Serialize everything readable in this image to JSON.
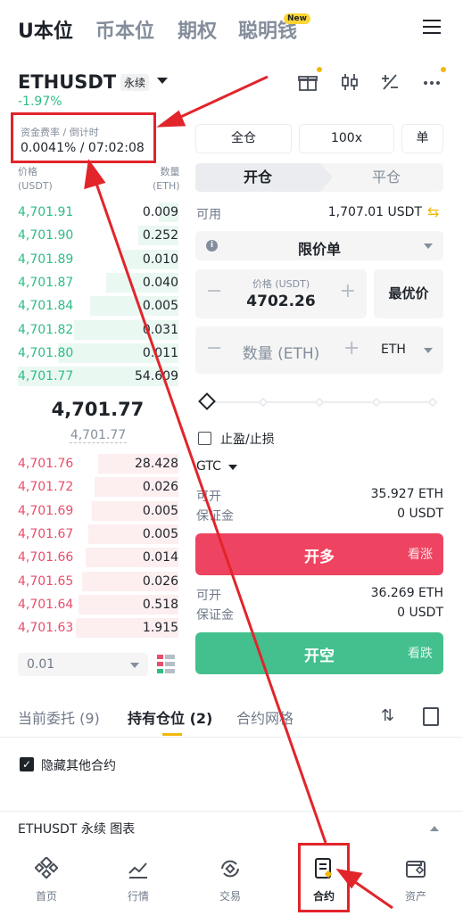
{
  "top_tabs": [
    "U本位",
    "币本位",
    "期权",
    "聪明钱"
  ],
  "new_badge": "New",
  "pair": {
    "name": "ETHUSDT",
    "type": "永续",
    "change": "-1.97%"
  },
  "funding": {
    "label": "资金费率 / 倒计时",
    "value": "0.0041% / 07:02:08"
  },
  "orderbook": {
    "price_header": "价格\n(USDT)",
    "qty_header": "数量\n(ETH)",
    "bids": [
      {
        "price": "4,701.91",
        "qty": "0.009",
        "depth": 0.12
      },
      {
        "price": "4,701.90",
        "qty": "0.252",
        "depth": 0.25
      },
      {
        "price": "4,701.89",
        "qty": "0.010",
        "depth": 0.35
      },
      {
        "price": "4,701.87",
        "qty": "0.040",
        "depth": 0.45
      },
      {
        "price": "4,701.84",
        "qty": "0.005",
        "depth": 0.55
      },
      {
        "price": "4,701.82",
        "qty": "0.031",
        "depth": 0.65
      },
      {
        "price": "4,701.80",
        "qty": "0.011",
        "depth": 0.75
      },
      {
        "price": "4,701.77",
        "qty": "54.609",
        "depth": 1.0
      }
    ],
    "mid_price": "4,701.77",
    "mark_price": "4,701.77",
    "asks": [
      {
        "price": "4,701.76",
        "qty": "28.428",
        "depth": 0.5
      },
      {
        "price": "4,701.72",
        "qty": "0.026",
        "depth": 0.52
      },
      {
        "price": "4,701.69",
        "qty": "0.005",
        "depth": 0.54
      },
      {
        "price": "4,701.67",
        "qty": "0.005",
        "depth": 0.56
      },
      {
        "price": "4,701.66",
        "qty": "0.014",
        "depth": 0.58
      },
      {
        "price": "4,701.65",
        "qty": "0.026",
        "depth": 0.6
      },
      {
        "price": "4,701.64",
        "qty": "0.518",
        "depth": 0.62
      },
      {
        "price": "4,701.63",
        "qty": "1.915",
        "depth": 0.64
      }
    ],
    "precision": "0.01"
  },
  "trade": {
    "margin_mode": "全仓",
    "leverage": "100x",
    "position_mode": "单",
    "open_tab": "开仓",
    "close_tab": "平仓",
    "avail_label": "可用",
    "avail_value": "1,707.01 USDT",
    "order_type": "限价单",
    "price_label": "价格 (USDT)",
    "price_value": "4702.26",
    "best_price": "最优价",
    "qty_placeholder": "数量 (ETH)",
    "qty_unit": "ETH",
    "tpsl": "止盈/止损",
    "tif": "GTC",
    "long_open_label": "可开",
    "long_open_value": "35.927 ETH",
    "long_margin_label": "保证金",
    "long_margin_value": "0 USDT",
    "long_btn": "开多",
    "long_btn_side": "看涨",
    "short_open_label": "可开",
    "short_open_value": "36.269 ETH",
    "short_margin_label": "保证金",
    "short_margin_value": "0 USDT",
    "short_btn": "开空",
    "short_btn_side": "看跌"
  },
  "bottom": {
    "tabs": [
      "当前委托 (9)",
      "持有仓位 (2)",
      "合约网格"
    ],
    "hide_other": "隐藏其他合约",
    "chart_bar": "ETHUSDT 永续  图表"
  },
  "nav": [
    {
      "label": "首页",
      "icon": "home-icon"
    },
    {
      "label": "行情",
      "icon": "markets-icon"
    },
    {
      "label": "交易",
      "icon": "trade-icon"
    },
    {
      "label": "合约",
      "icon": "futures-icon"
    },
    {
      "label": "资产",
      "icon": "wallet-icon"
    }
  ],
  "colors": {
    "green": "#2ebd85",
    "red": "#e84e6a",
    "annotation": "#e2242b",
    "accent": "#f0b90b"
  }
}
